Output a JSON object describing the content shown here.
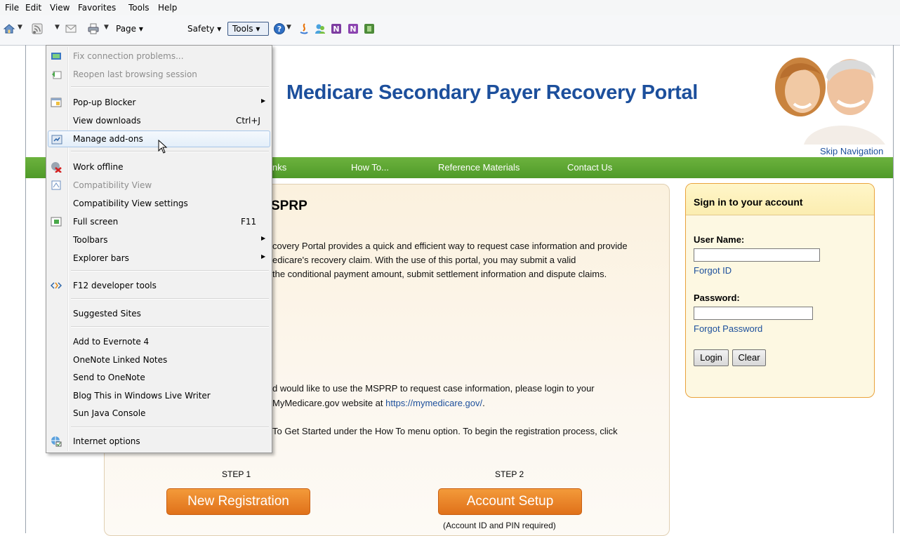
{
  "menubar": {
    "items": [
      "File",
      "Edit",
      "View",
      "Favorites",
      "Tools",
      "Help"
    ]
  },
  "commandbar": {
    "page_label": "Page",
    "safety_label": "Safety",
    "tools_label": "Tools"
  },
  "tools_menu": {
    "items": [
      {
        "label": "Fix connection problems...",
        "shortcut": ""
      },
      {
        "label": "Reopen last browsing session",
        "shortcut": ""
      },
      {
        "label": "Pop-up Blocker",
        "shortcut": ""
      },
      {
        "label": "View downloads",
        "shortcut": "Ctrl+J"
      },
      {
        "label": "Manage add-ons",
        "shortcut": ""
      },
      {
        "label": "Work offline",
        "shortcut": ""
      },
      {
        "label": "Compatibility View",
        "shortcut": ""
      },
      {
        "label": "Compatibility View settings",
        "shortcut": ""
      },
      {
        "label": "Full screen",
        "shortcut": "F11"
      },
      {
        "label": "Toolbars",
        "shortcut": ""
      },
      {
        "label": "Explorer bars",
        "shortcut": ""
      },
      {
        "label": "F12 developer tools",
        "shortcut": ""
      },
      {
        "label": "Suggested Sites",
        "shortcut": ""
      },
      {
        "label": "Add to Evernote 4",
        "shortcut": ""
      },
      {
        "label": "OneNote Linked Notes",
        "shortcut": ""
      },
      {
        "label": "Send to OneNote",
        "shortcut": ""
      },
      {
        "label": "Blog This in Windows Live Writer",
        "shortcut": ""
      },
      {
        "label": "Sun Java Console",
        "shortcut": ""
      },
      {
        "label": "Internet options",
        "shortcut": ""
      }
    ]
  },
  "site": {
    "title": "Medicare Secondary Payer Recovery Portal",
    "skip_nav": "Skip Navigation",
    "nav": [
      "nks",
      "How To...",
      "Reference Materials",
      "Contact Us"
    ],
    "heading": "SPRP",
    "intro_lines": [
      "covery Portal provides a quick and efficient way to request case information and provide",
      "edicare's recovery claim. With the use of this portal, you may submit a valid",
      "the conditional payment amount, submit settlement information and dispute claims."
    ],
    "login_line1": "d would like to use the MSPRP to request case information, please login to your",
    "login_line2_text": "MyMedicare.gov website at ",
    "login_line2_link": "https://mymedicare.gov/",
    "login_line2_end": ".",
    "howto_line": "To Get Started under the How To menu option. To begin the registration process, click",
    "step1_label": "STEP 1",
    "step2_label": "STEP 2",
    "step1_button": "New Registration",
    "step2_button": "Account Setup",
    "step2_note": "(Account ID and PIN required)"
  },
  "signin": {
    "title": "Sign in to your account",
    "username_label": "User Name:",
    "username_value": "",
    "forgot_id": "Forgot ID",
    "password_label": "Password:",
    "password_value": "",
    "forgot_password": "Forgot Password",
    "login_button": "Login",
    "clear_button": "Clear"
  },
  "colors": {
    "title_blue": "#1c4f9c",
    "nav_green": "#5fa832",
    "button_orange": "#ea8628",
    "signin_border": "#e9a23b"
  }
}
